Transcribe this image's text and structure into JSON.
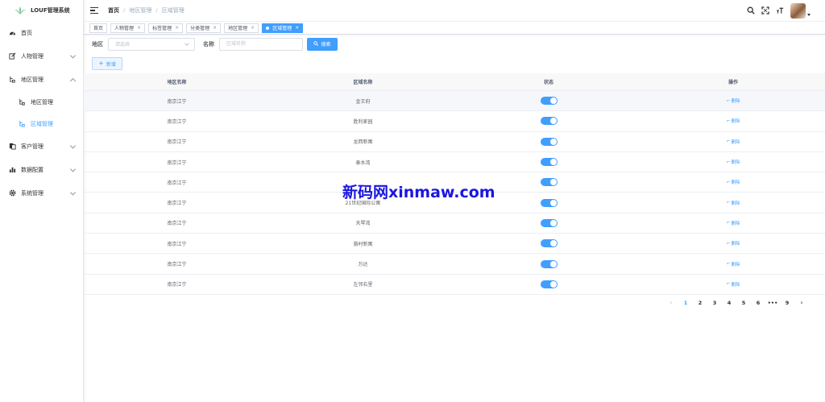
{
  "app": {
    "title": "LOUF管理系统"
  },
  "sidebar": {
    "items": [
      {
        "label": "首页",
        "icon": "dashboard-icon"
      },
      {
        "label": "人物管理",
        "icon": "edit-icon"
      },
      {
        "label": "地区管理",
        "icon": "region-icon"
      },
      {
        "label": "地区管理",
        "icon": "region-icon"
      },
      {
        "label": "区域管理",
        "icon": "region-icon"
      },
      {
        "label": "客户管理",
        "icon": "copy-icon"
      },
      {
        "label": "数据配置",
        "icon": "chart-icon"
      },
      {
        "label": "系统管理",
        "icon": "gear-icon"
      }
    ]
  },
  "breadcrumb": [
    "首页",
    "地区管理",
    "区域管理"
  ],
  "tags": [
    {
      "label": "首页"
    },
    {
      "label": "人物管理"
    },
    {
      "label": "标签管理"
    },
    {
      "label": "分类管理"
    },
    {
      "label": "地区管理"
    },
    {
      "label": "区域管理"
    }
  ],
  "search": {
    "region_label": "地区",
    "region_placeholder": "请选择",
    "name_label": "名称",
    "name_placeholder": "区域名称",
    "search_button": "搜索"
  },
  "toolbar": {
    "add_button": "新增"
  },
  "table": {
    "columns": [
      "地区名称",
      "区域名称",
      "状态",
      "操作"
    ],
    "rows": [
      {
        "region": "南京江宁",
        "area": "金王府",
        "status": true,
        "action": "删除"
      },
      {
        "region": "南京江宁",
        "area": "胜利家园",
        "status": true,
        "action": "删除"
      },
      {
        "region": "南京江宁",
        "area": "龙西新寓",
        "status": true,
        "action": "删除"
      },
      {
        "region": "南京江宁",
        "area": "泰水湾",
        "status": true,
        "action": "删除"
      },
      {
        "region": "南京江宁",
        "area": "",
        "status": true,
        "action": "删除"
      },
      {
        "region": "南京江宁",
        "area": "21世纪国际公寓",
        "status": true,
        "action": "删除"
      },
      {
        "region": "南京江宁",
        "area": "天琴湾",
        "status": true,
        "action": "删除"
      },
      {
        "region": "南京江宁",
        "area": "骆村新寓",
        "status": true,
        "action": "删除"
      },
      {
        "region": "南京江宁",
        "area": "万达",
        "status": true,
        "action": "删除"
      },
      {
        "region": "南京江宁",
        "area": "左邻右里",
        "status": true,
        "action": "删除"
      }
    ]
  },
  "pagination": {
    "pages": [
      "1",
      "2",
      "3",
      "4",
      "5",
      "6",
      "•••",
      "9"
    ],
    "current": "1",
    "prev": "‹",
    "next": "›"
  },
  "watermark": "新码网xinmaw.com",
  "colors": {
    "primary": "#409eff",
    "text": "#303133",
    "muted": "#606266",
    "watermark": "#1a16e0"
  }
}
